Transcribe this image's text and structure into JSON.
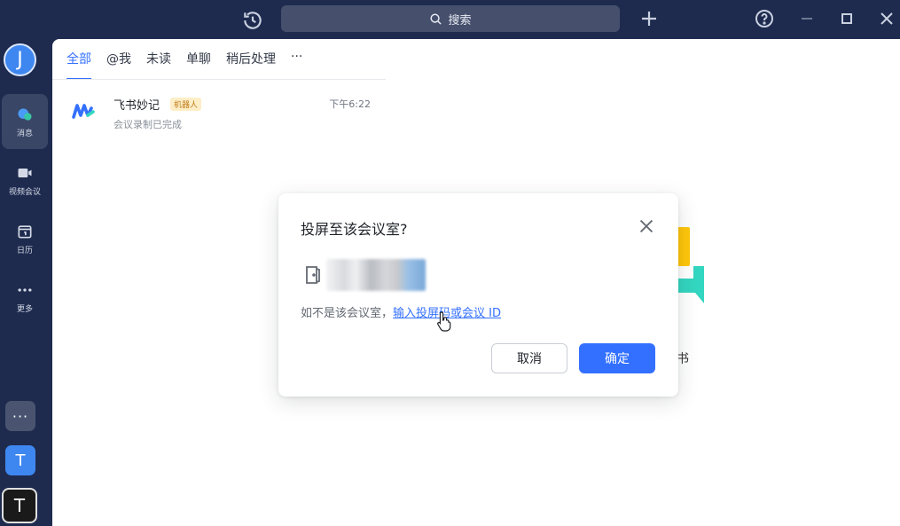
{
  "topbar": {
    "search_label": "搜索"
  },
  "rail": {
    "avatar_letter": "J",
    "items": [
      {
        "label": "消息",
        "icon": "chat-bubble-icon"
      },
      {
        "label": "视频会议",
        "icon": "video-camera-icon"
      },
      {
        "label": "日历",
        "icon": "calendar-icon"
      },
      {
        "label": "更多",
        "icon": "more-dots-icon"
      }
    ],
    "more_btn": "···",
    "workspace_t1": "T",
    "workspace_t2": "T"
  },
  "chat_list": {
    "tabs": [
      "全部",
      "@我",
      "未读",
      "单聊",
      "稍后处理",
      "···"
    ],
    "active_tab": 0,
    "rows": [
      {
        "name": "飞书妙记",
        "badge": "机器人",
        "time": "下午6:22",
        "subtitle": "会议录制已完成"
      }
    ]
  },
  "right_area": {
    "app_name_fragment": "书"
  },
  "dialog": {
    "title": "投屏至该会议室?",
    "hint_prefix": "如不是该会议室，",
    "hint_link": "输入投屏码或会议 ID",
    "cancel_label": "取消",
    "ok_label": "确定"
  },
  "colors": {
    "sidebar_bg": "#1e2b4f",
    "accent": "#3370ff",
    "avatar": "#3f87f0",
    "badge_bg": "#fdeec7",
    "badge_fg": "#c07a18"
  }
}
